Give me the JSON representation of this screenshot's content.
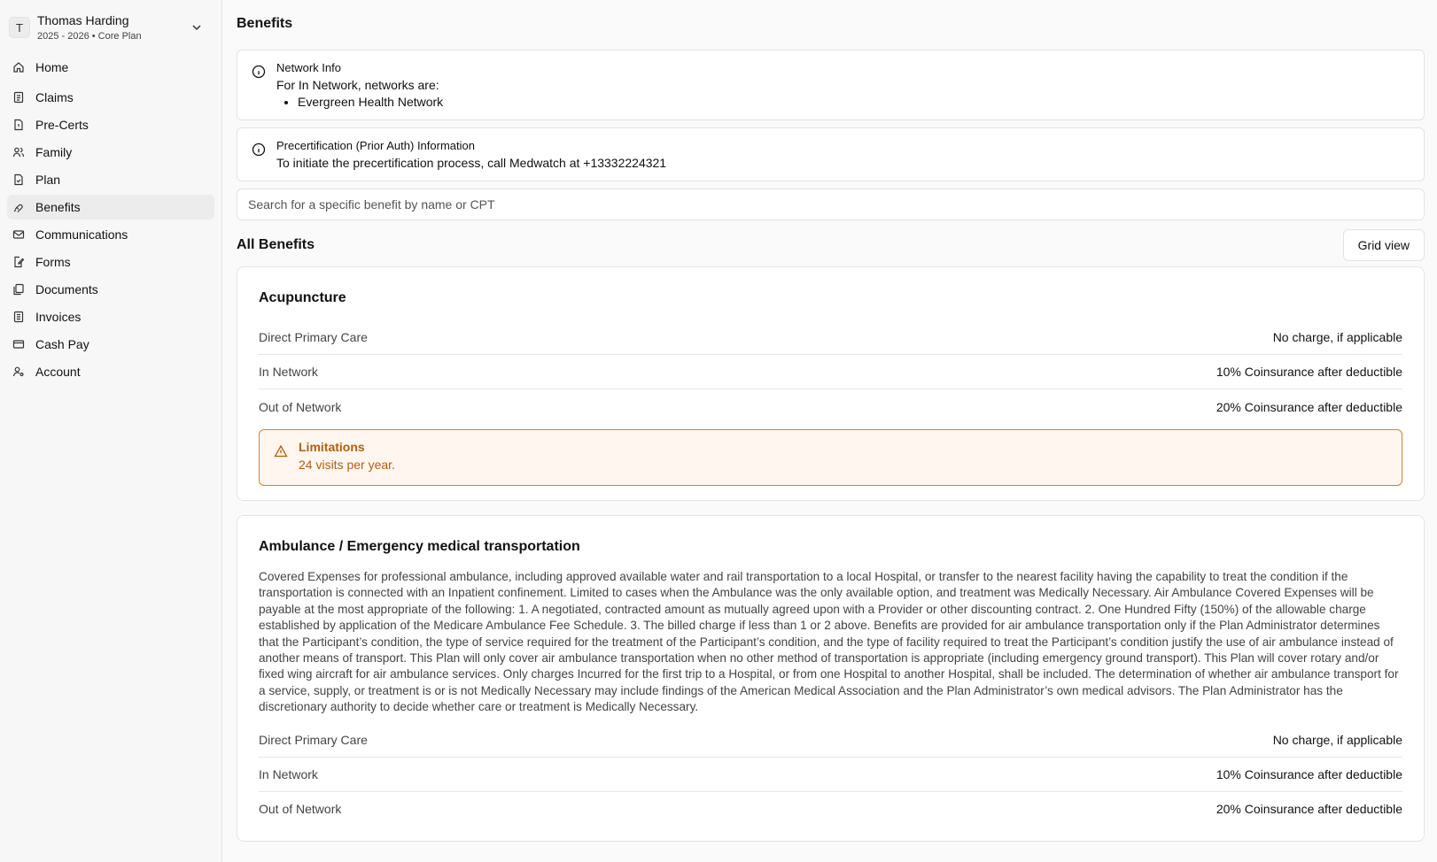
{
  "account": {
    "initial": "T",
    "name": "Thomas Harding",
    "subtitle": "2025 - 2026 • Core Plan"
  },
  "nav": [
    {
      "label": "Home",
      "icon": "home-icon"
    },
    {
      "label": "Claims",
      "icon": "claims-icon"
    },
    {
      "label": "Pre-Certs",
      "icon": "precert-icon"
    },
    {
      "label": "Family",
      "icon": "family-icon"
    },
    {
      "label": "Plan",
      "icon": "plan-icon"
    },
    {
      "label": "Benefits",
      "icon": "benefits-icon",
      "active": true
    },
    {
      "label": "Communications",
      "icon": "mail-icon"
    },
    {
      "label": "Forms",
      "icon": "forms-icon"
    },
    {
      "label": "Documents",
      "icon": "documents-icon"
    },
    {
      "label": "Invoices",
      "icon": "invoices-icon"
    },
    {
      "label": "Cash Pay",
      "icon": "card-icon"
    },
    {
      "label": "Account",
      "icon": "account-icon"
    }
  ],
  "page": {
    "title": "Benefits",
    "network_info": {
      "title": "Network Info",
      "text": "For In Network, networks are:",
      "networks": [
        "Evergreen Health Network"
      ]
    },
    "precert_info": {
      "title": "Precertification (Prior Auth) Information",
      "text": "To initiate the precertification process, call Medwatch at +13332224321"
    },
    "search_placeholder": "Search for a specific benefit by name or CPT",
    "all_benefits_title": "All Benefits",
    "grid_view_label": "Grid view"
  },
  "benefits": [
    {
      "title": "Acupuncture",
      "rows": [
        {
          "label": "Direct Primary Care",
          "value": "No charge, if applicable"
        },
        {
          "label": "In Network",
          "value": "10% Coinsurance after deductible"
        },
        {
          "label": "Out of Network",
          "value": "20% Coinsurance after deductible"
        }
      ],
      "limitations_title": "Limitations",
      "limitations_text": "24 visits per year."
    },
    {
      "title": "Ambulance / Emergency medical transportation",
      "description": "Covered Expenses for professional ambulance, including approved available water and rail transportation to a local Hospital, or transfer to the nearest facility having the capability to treat the condition if the transportation is connected with an Inpatient confinement. Limited to cases when the Ambulance was the only available option, and treatment was Medically Necessary. Air Ambulance Covered Expenses will be payable at the most appropriate of the following: 1. A negotiated, contracted amount as mutually agreed upon with a Provider or other discounting contract. 2. One Hundred Fifty (150%) of the allowable charge established by application of the Medicare Ambulance Fee Schedule. 3. The billed charge if less than 1 or 2 above. Benefits are provided for air ambulance transportation only if the Plan Administrator determines that the Participant’s condition, the type of service required for the treatment of the Participant’s condition, and the type of facility required to treat the Participant’s condition justify the use of air ambulance instead of another means of transport. This Plan will only cover air ambulance transportation when no other method of transportation is appropriate (including emergency ground transport). This Plan will cover rotary and/or fixed wing aircraft for air ambulance services. Only charges Incurred for the first trip to a Hospital, or from one Hospital to another Hospital, shall be included. The determination of whether air ambulance transport for a service, supply, or treatment is or is not Medically Necessary may include findings of the American Medical Association and the Plan Administrator’s own medical advisors. The Plan Administrator has the discretionary authority to decide whether care or treatment is Medically Necessary.",
      "rows": [
        {
          "label": "Direct Primary Care",
          "value": "No charge, if applicable"
        },
        {
          "label": "In Network",
          "value": "10% Coinsurance after deductible"
        },
        {
          "label": "Out of Network",
          "value": "20% Coinsurance after deductible"
        }
      ]
    }
  ]
}
